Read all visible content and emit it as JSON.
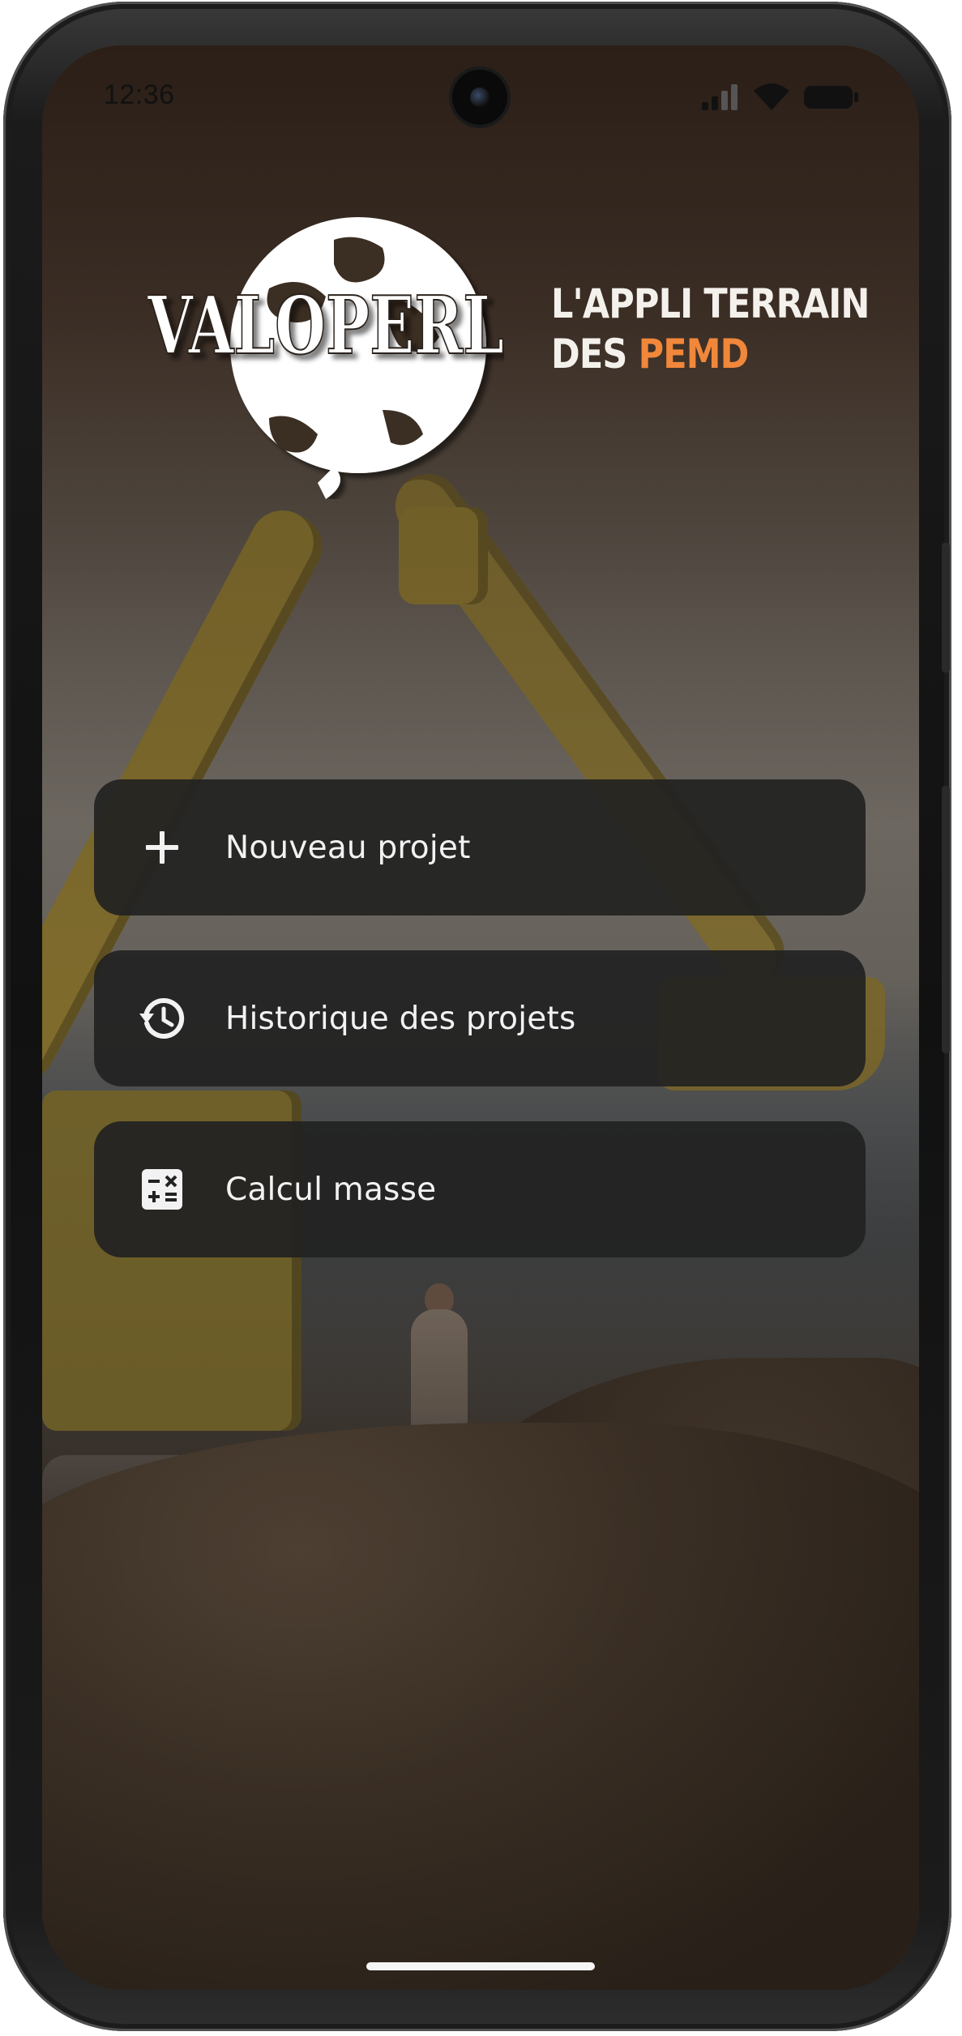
{
  "status_bar": {
    "time": "12:36"
  },
  "brand": {
    "logo_text": "VALOPERL",
    "tagline_line1": "L'APPLI TERRAIN",
    "tagline_line2_prefix": "DES",
    "tagline_line2_accent": "PEMD",
    "accent_color": "#f0873a"
  },
  "menu": {
    "items": [
      {
        "label": "Nouveau projet",
        "icon": "plus-icon"
      },
      {
        "label": "Historique des projets",
        "icon": "history-icon"
      },
      {
        "label": "Calcul masse",
        "icon": "calculator-icon"
      }
    ]
  }
}
